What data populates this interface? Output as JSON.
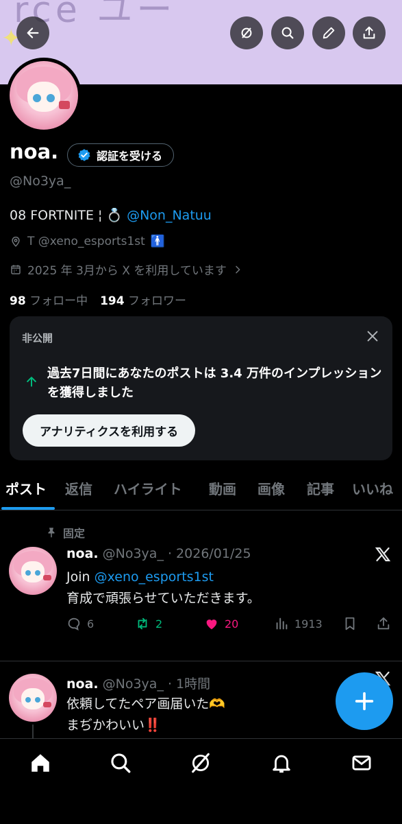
{
  "banner": {
    "scribble_text": "rce ユー"
  },
  "profile": {
    "display_name": "noa.",
    "verify_label": "認証を受ける",
    "handle": "@No3ya_",
    "bio_prefix": "08 FORTNITE ¦ ",
    "bio_ring": "💍",
    "bio_link": "@Non_Natuu",
    "location": "T @xeno_esports1st",
    "location_emoji": "🚹",
    "joined": "2025 年 3月から X を利用しています",
    "following_count": "98",
    "following_label": "フォロー中",
    "followers_count": "194",
    "followers_label": "フォロワー"
  },
  "analytics_card": {
    "private_label": "非公開",
    "text": "過去7日間にあなたのポストは 3.4 万件のインプレッションを獲得しました",
    "button_label": "アナリティクスを利用する"
  },
  "tabs": [
    "ポスト",
    "返信",
    "ハイライト",
    "動画",
    "画像",
    "記事",
    "いいね"
  ],
  "posts": [
    {
      "pinned_label": "固定",
      "name": "noa.",
      "handle_time": "@No3ya_ · 2026/01/25",
      "line1_prefix": "Join ",
      "line1_link": "@xeno_esports1st",
      "line2": "育成で頑張らせていただきます。",
      "replies": "6",
      "reposts": "2",
      "likes": "20",
      "views": "1913"
    },
    {
      "name": "noa.",
      "handle_time": "@No3ya_ · 1時間",
      "line1": "依頼してたペア画届いた🫶",
      "line2": "まぢかわいい‼️"
    }
  ],
  "colors": {
    "accent": "#1d9bf0",
    "like": "#f91880",
    "repost": "#00ba7c",
    "banner": "#d8c8ef"
  },
  "icons": [
    "back-arrow-icon",
    "hide-circle-icon",
    "search-icon",
    "pencil-icon",
    "share-icon",
    "verified-badge-icon",
    "location-pin-icon",
    "calendar-icon",
    "chevron-right-icon",
    "close-icon",
    "arrow-up-icon",
    "pin-icon",
    "x-logo-icon",
    "reply-icon",
    "repost-icon",
    "like-icon",
    "views-icon",
    "bookmark-icon",
    "compose-plus-icon",
    "home-icon",
    "grok-icon",
    "bell-icon",
    "mail-icon"
  ]
}
